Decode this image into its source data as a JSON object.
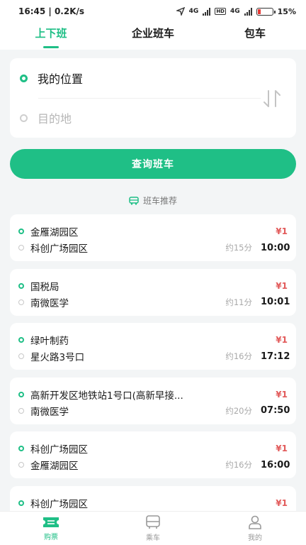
{
  "status_bar": {
    "time": "16:45",
    "speed": "0.2K/s",
    "net1": "4G",
    "net2": "4G",
    "hd": "HD",
    "battery": "15"
  },
  "tabs": [
    {
      "label": "上下班",
      "active": true
    },
    {
      "label": "企业班车",
      "active": false
    },
    {
      "label": "包车",
      "active": false
    }
  ],
  "route": {
    "from": "我的位置",
    "to_placeholder": "目的地"
  },
  "query_button": "查询班车",
  "recommend_title": "班车推荐",
  "trips": [
    {
      "from": "金雁湖园区",
      "to": "科创广场园区",
      "price": "¥1",
      "duration": "约15分",
      "time": "10:00"
    },
    {
      "from": "国税局",
      "to": "南微医学",
      "price": "¥1",
      "duration": "约11分",
      "time": "10:01"
    },
    {
      "from": "绿叶制药",
      "to": "星火路3号口",
      "price": "¥1",
      "duration": "约16分",
      "time": "17:12"
    },
    {
      "from": "高新开发区地铁站1号口(高新早接...",
      "to": "南微医学",
      "price": "¥1",
      "duration": "约20分",
      "time": "07:50"
    },
    {
      "from": "科创广场园区",
      "to": "金雁湖园区",
      "price": "¥1",
      "duration": "约16分",
      "time": "16:00"
    },
    {
      "from": "科创广场园区",
      "to": "",
      "price": "¥1",
      "duration": "",
      "time": ""
    }
  ],
  "nav": [
    {
      "label": "购票",
      "icon": "ticket-icon",
      "active": true
    },
    {
      "label": "乘车",
      "icon": "bus-icon",
      "active": false
    },
    {
      "label": "我的",
      "icon": "user-icon",
      "active": false
    }
  ],
  "colors": {
    "accent": "#1fbf86",
    "price": "#e25b5b"
  }
}
